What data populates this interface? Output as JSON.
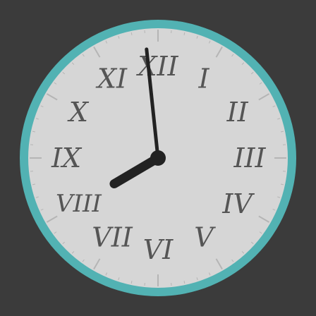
{
  "clock": {
    "time": {
      "hour": 7,
      "minute": 59
    },
    "numerals": [
      {
        "hour": 12,
        "text": "XII"
      },
      {
        "hour": 1,
        "text": "I"
      },
      {
        "hour": 2,
        "text": "II"
      },
      {
        "hour": 3,
        "text": "III"
      },
      {
        "hour": 4,
        "text": "IV"
      },
      {
        "hour": 5,
        "text": "V"
      },
      {
        "hour": 6,
        "text": "VI"
      },
      {
        "hour": 7,
        "text": "VII"
      },
      {
        "hour": 8,
        "text": "VIII"
      },
      {
        "hour": 9,
        "text": "IX"
      },
      {
        "hour": 10,
        "text": "X"
      },
      {
        "hour": 11,
        "text": "XI"
      }
    ],
    "colors": {
      "background": "#3b3b3b",
      "rim": "#52b2b3",
      "face": "#d6d6d6",
      "hands": "#222222",
      "numerals": "#555555",
      "ticks": "#b5b5b5"
    }
  }
}
